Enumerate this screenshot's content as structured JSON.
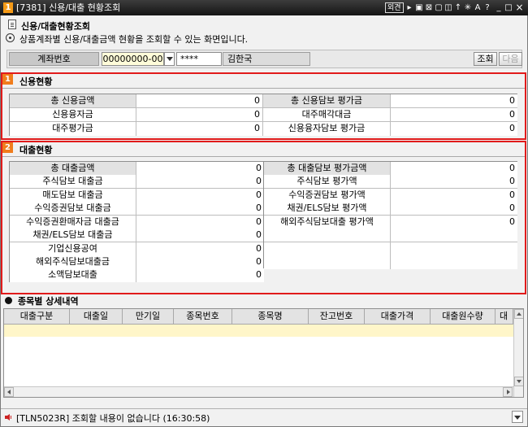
{
  "window": {
    "app_number": "1",
    "title": "[7381] 신용/대출 현황조회",
    "badge": "외견",
    "icons": [
      "arrow-right-icon",
      "dock-icon",
      "close-box-icon",
      "copy-icon",
      "split-icon",
      "pin-icon",
      "sparkle-icon",
      "text-size-icon",
      "help-icon",
      "minimize-icon",
      "maximize-icon",
      "close-icon"
    ],
    "glyphs": {
      "arrow": "▸",
      "dock": "▣",
      "closebox": "⊠",
      "copy": "▢",
      "split": "◫",
      "pin": "↑",
      "sparkle": "✳",
      "text": "A",
      "help": "?",
      "min": "_",
      "max": "□",
      "close": "×"
    }
  },
  "header": {
    "screen_title": "신용/대출현황조회",
    "description": "상품계좌별 신용/대출금액 현황을 조회할 수 있는 화면입니다."
  },
  "account": {
    "label": "계좌번호",
    "number": "00000000-00",
    "password": "****",
    "owner": "김한국",
    "query_button": "조회",
    "next_button": "다음"
  },
  "credit": {
    "section_num": "1",
    "section_title": "신용현황",
    "left": [
      {
        "label": "총 신용금액",
        "value": "0"
      },
      {
        "label": "신용융자금",
        "value": "0"
      },
      {
        "label": "대주평가금",
        "value": "0"
      }
    ],
    "right": [
      {
        "label": "총 신용담보 평가금",
        "value": "0"
      },
      {
        "label": "대주매각대금",
        "value": "0"
      },
      {
        "label": "신용융자담보 평가금",
        "value": "0"
      }
    ]
  },
  "loan": {
    "section_num": "2",
    "section_title": "대출현황",
    "left": [
      {
        "label": "총 대출금액",
        "value": "0"
      },
      {
        "label": "주식담보 대출금",
        "value": "0"
      },
      {
        "label": "매도담보 대출금",
        "value": "0"
      },
      {
        "label": "수익증권담보 대출금",
        "value": "0"
      },
      {
        "label": "수익증권환매자금 대출금",
        "value": "0"
      },
      {
        "label": "채권/ELS담보 대출금",
        "value": "0"
      },
      {
        "label": "기업신용공여",
        "value": "0"
      },
      {
        "label": "해외주식담보대출금",
        "value": "0"
      },
      {
        "label": "소액담보대출",
        "value": "0"
      }
    ],
    "right": [
      {
        "label": "총 대출담보 평가금액",
        "value": "0"
      },
      {
        "label": "주식담보 평가액",
        "value": "0"
      },
      {
        "label": "수익증권담보 평가액",
        "value": "0"
      },
      {
        "label": "채권/ELS담보 평가액",
        "value": "0"
      },
      {
        "label": "해외주식담보대출 평가액",
        "value": "0"
      },
      {
        "label": "",
        "value": ""
      },
      {
        "label": "",
        "value": ""
      },
      {
        "label": "",
        "value": ""
      }
    ]
  },
  "detail": {
    "title": "종목별 상세내역",
    "columns": [
      "대출구분",
      "대출일",
      "만기일",
      "종목번호",
      "종목명",
      "잔고번호",
      "대출가격",
      "대출원수량",
      "대"
    ]
  },
  "status": {
    "message": "[TLN5023R] 조회할 내용이 없습니다 (16:30:58)"
  },
  "colors": {
    "accent_orange": "#f07c1c",
    "section_border": "#e11b1b",
    "input_yellow": "#fffcd9",
    "selected_row": "#fff6c9"
  }
}
